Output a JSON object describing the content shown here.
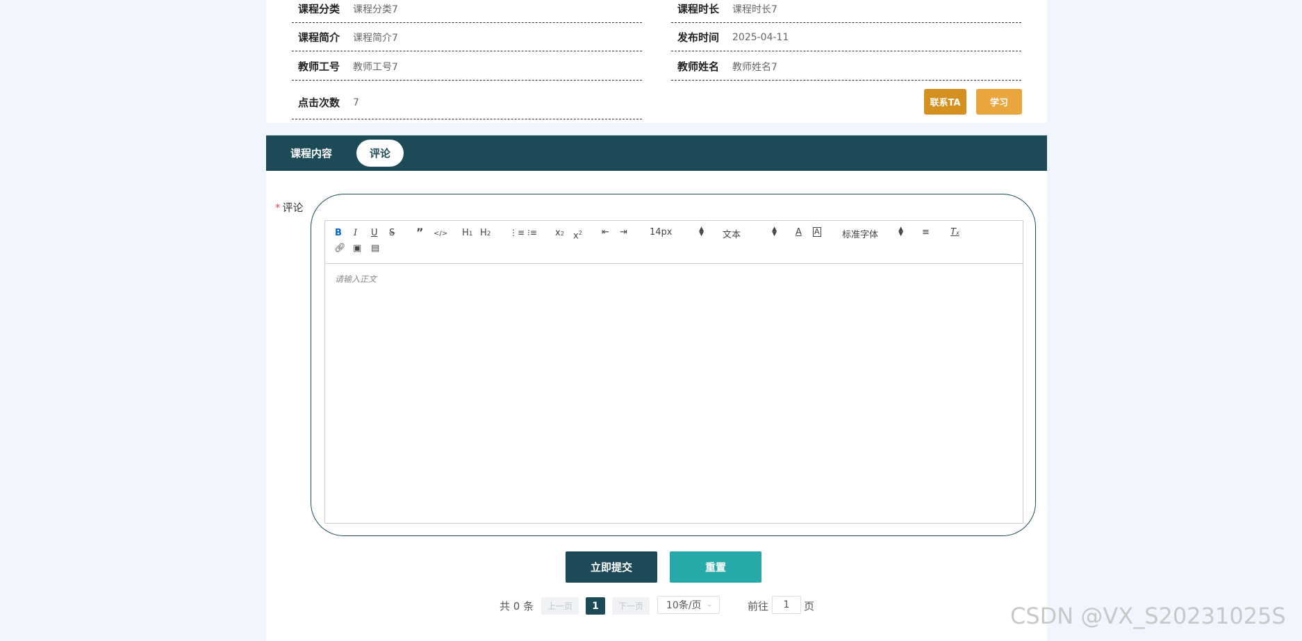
{
  "colors": {
    "page_bg": "#f1f5fd",
    "tab_bar": "#1c4a57",
    "contact_button": "#d4911f",
    "study_button": "#e9a63c",
    "submit_button": "#1c4a57",
    "reset_button": "#27a9a9",
    "required_star": "#e14c4c"
  },
  "info": {
    "category": {
      "label": "课程分类",
      "value": "课程分类7"
    },
    "duration": {
      "label": "课程时长",
      "value": "课程时长7"
    },
    "intro": {
      "label": "课程简介",
      "value": "课程简介7"
    },
    "publish_time": {
      "label": "发布时间",
      "value": "2025-04-11"
    },
    "teacher_id": {
      "label": "教师工号",
      "value": "教师工号7"
    },
    "teacher_name": {
      "label": "教师姓名",
      "value": "教师姓名7"
    },
    "clicks": {
      "label": "点击次数",
      "value": "7"
    }
  },
  "actions": {
    "contact": "联系TA",
    "study": "学习"
  },
  "tabs": [
    {
      "label": "课程内容",
      "active": false
    },
    {
      "label": "评论",
      "active": true
    }
  ],
  "comment_form": {
    "required_mark": "*",
    "label": "评论",
    "placeholder": "请输入正文",
    "toolbar": {
      "font_size": "14px",
      "header": "文本",
      "font_family": "标准字体",
      "icons": [
        "bold-icon",
        "italic-icon",
        "underline-icon",
        "strike-icon",
        "blockquote-icon",
        "code-block-icon",
        "h1-icon",
        "h2-icon",
        "ordered-list-icon",
        "bullet-list-icon",
        "subscript-icon",
        "superscript-icon",
        "outdent-icon",
        "indent-icon",
        "font-color-icon",
        "background-color-icon",
        "align-icon",
        "clean-icon",
        "link-icon",
        "image-icon",
        "video-icon"
      ]
    },
    "submit": "立即提交",
    "reset": "重置"
  },
  "pagination": {
    "total": "共 0 条",
    "prev": "上一页",
    "current": "1",
    "next": "下一页",
    "page_size": "10条/页",
    "goto_prefix": "前往",
    "goto_value": "1",
    "goto_suffix": "页"
  },
  "watermark": "CSDN @VX_S20231025S"
}
